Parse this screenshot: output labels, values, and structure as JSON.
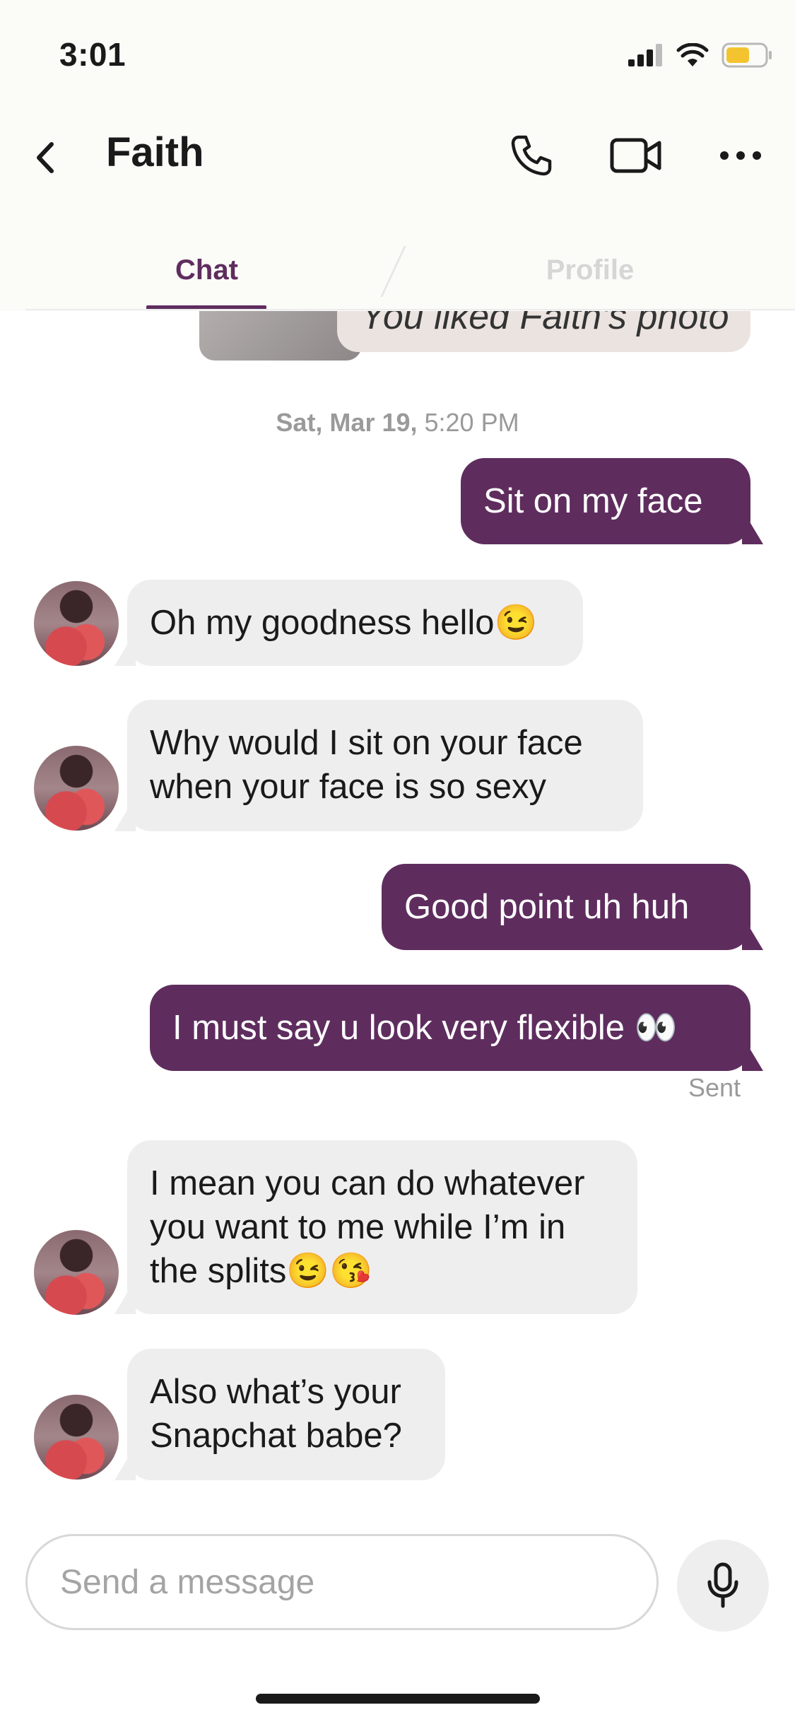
{
  "status_bar": {
    "time": "3:01",
    "battery_color": "#f4c430"
  },
  "header": {
    "back_icon": "chevron-left-icon",
    "contact_name": "Faith",
    "actions": [
      "phone-icon",
      "video-camera-icon",
      "more-icon"
    ]
  },
  "tabs": {
    "chat": "Chat",
    "profile": "Profile",
    "active": "Chat",
    "accent_color": "#5e2d5e"
  },
  "messages": {
    "liked_notice": "You liked Faith's photo",
    "date_day": "Sat, Mar 19,",
    "date_time": "5:20 PM",
    "m1": "Sit on my face",
    "m2": "Oh my goodness hello😉",
    "m3_line1": "Why would I sit on your face",
    "m3_line2": "when your face is so sexy",
    "m4": "Good point uh huh",
    "m5": "I must say u  look very flexible 👀",
    "sent_status": "Sent",
    "m6_line1": "I mean you can do whatever",
    "m6_line2": "you want to me while I’m in",
    "m6_line3": "the splits😉😘",
    "m7_line1": "Also what’s your",
    "m7_line2": "Snapchat babe?"
  },
  "composer": {
    "placeholder": "Send a message",
    "mic_icon": "microphone-icon"
  },
  "colors": {
    "outgoing_bubble": "#5e2d5e",
    "incoming_bubble": "#eeeeee"
  }
}
